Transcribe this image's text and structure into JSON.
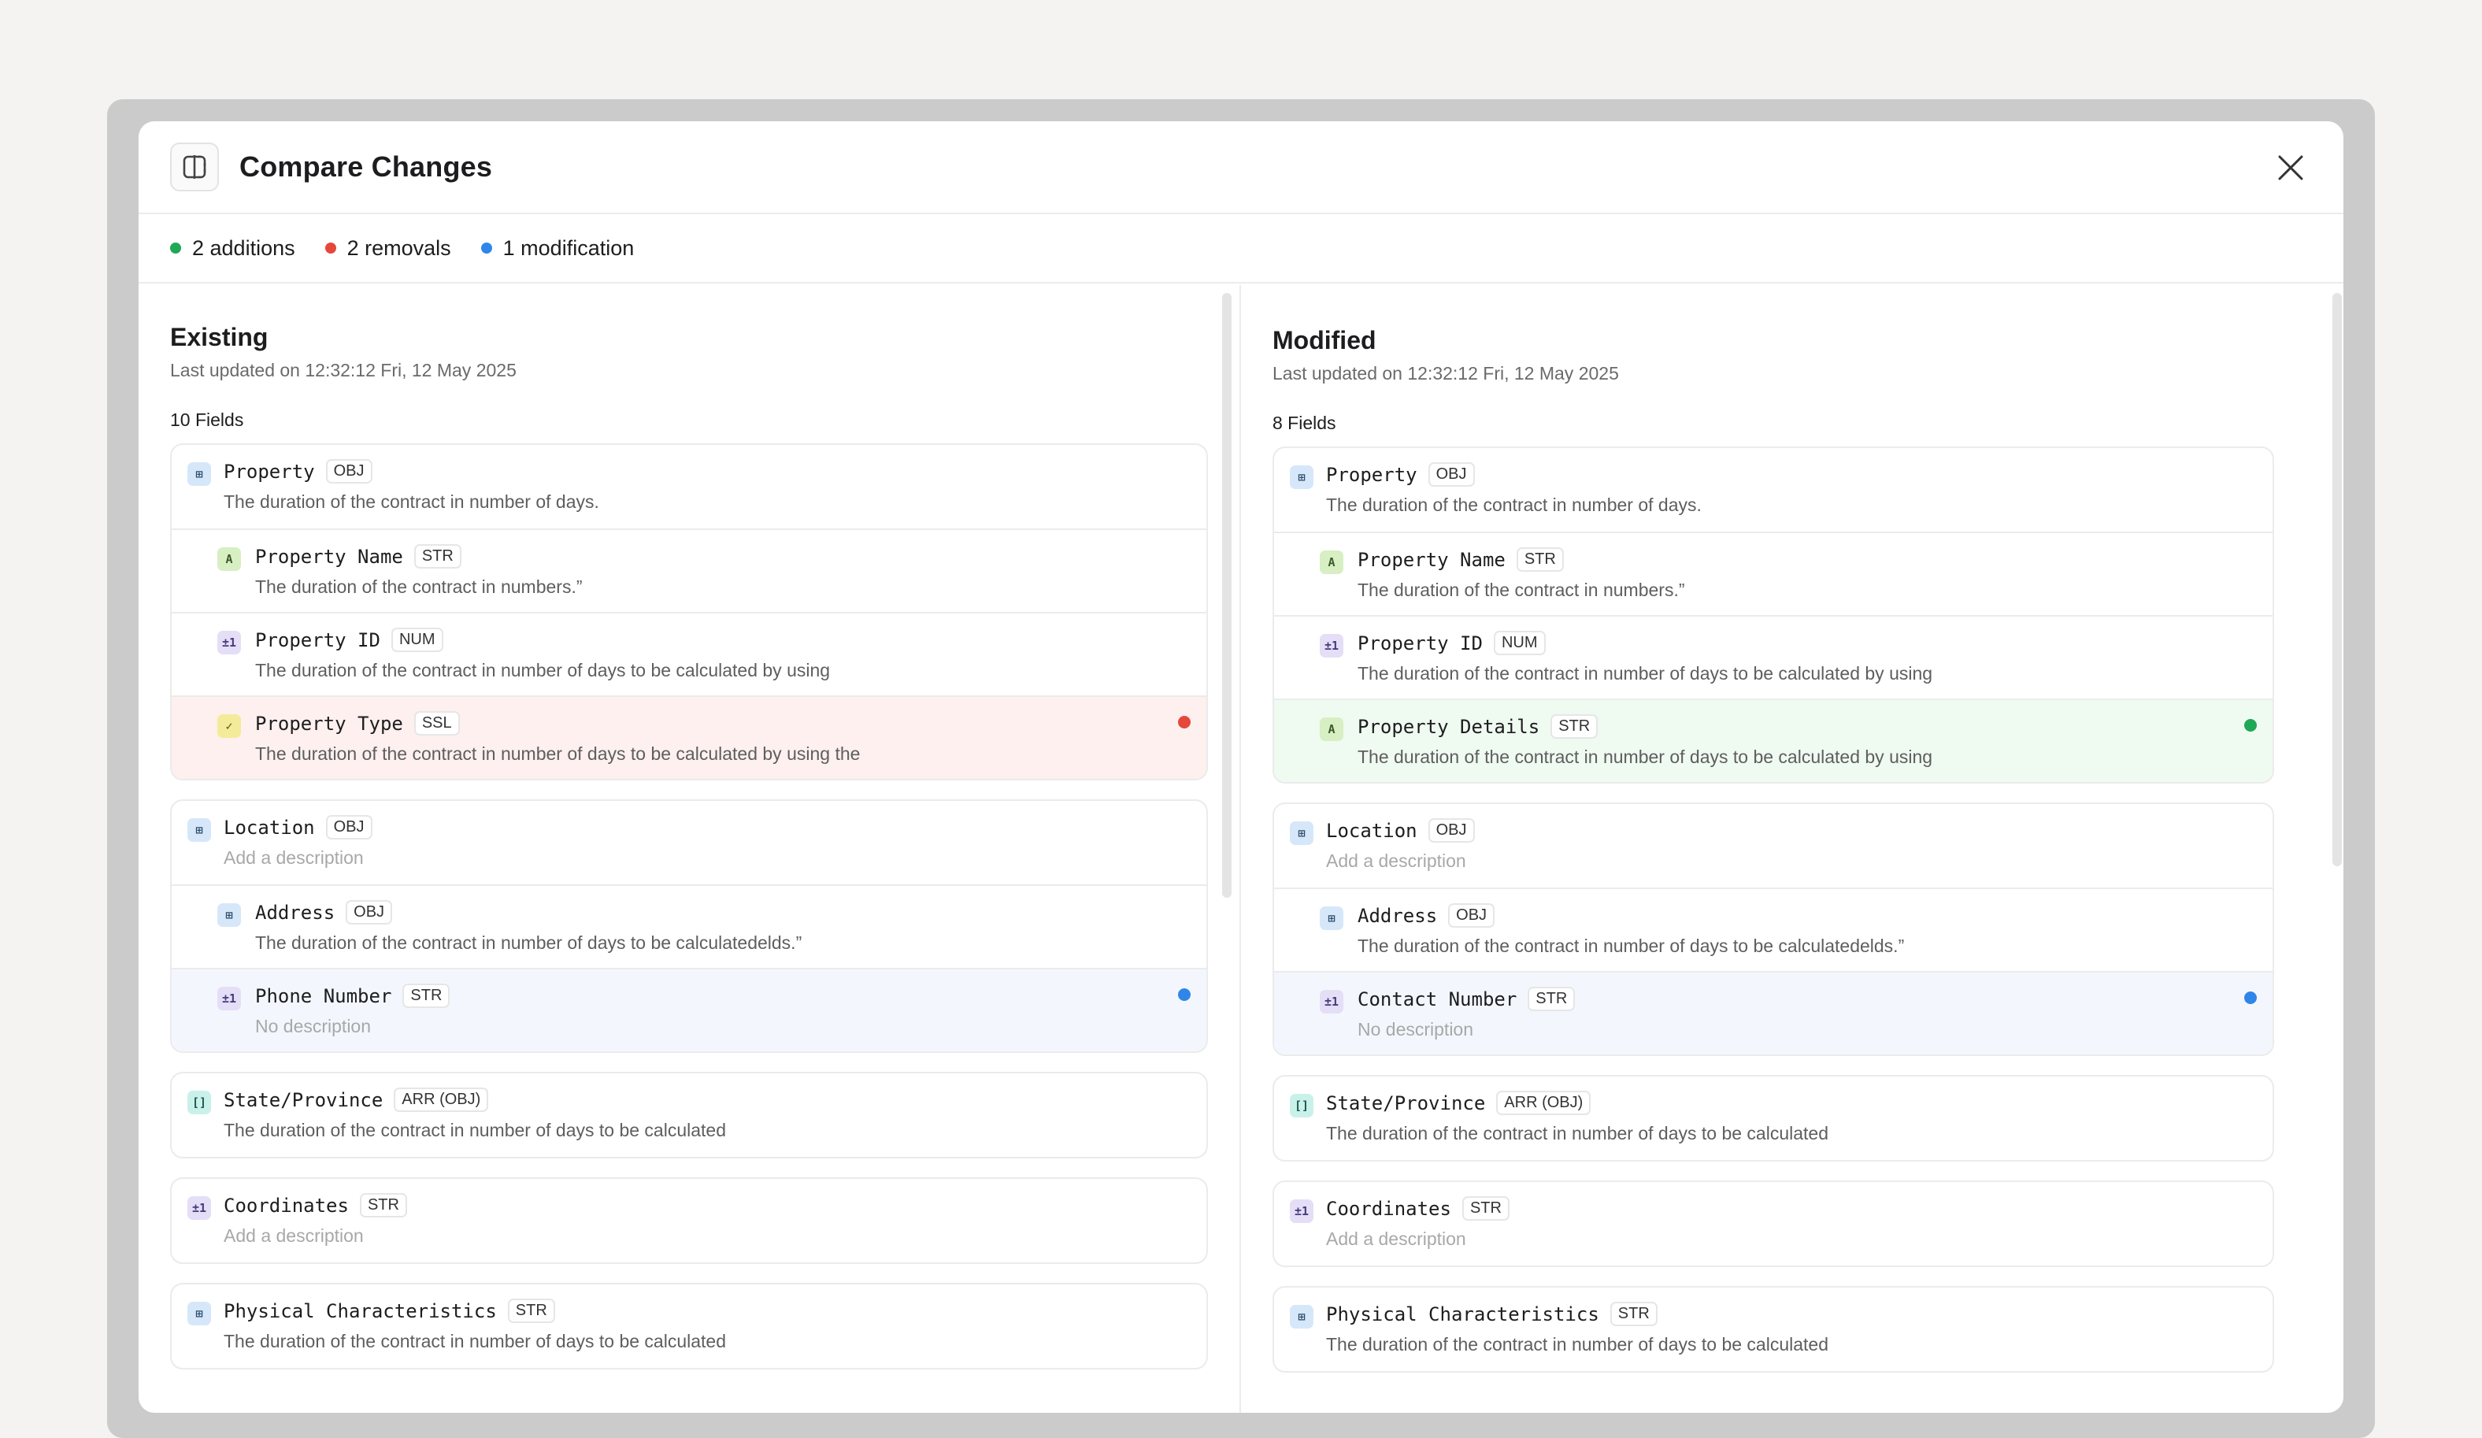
{
  "header": {
    "title": "Compare Changes"
  },
  "summary": [
    {
      "label": "2 additions",
      "color": "#1fa855"
    },
    {
      "label": "2 removals",
      "color": "#e5483b"
    },
    {
      "label": "1 modification",
      "color": "#2f86e8"
    }
  ],
  "existing": {
    "title": "Existing",
    "updated": "Last updated on 12:32:12 Fri, 12 May 2025",
    "field_count": "10 Fields",
    "groups": [
      {
        "rows": [
          {
            "name": "Property",
            "type": "OBJ",
            "icon": "object-icon",
            "desc": "The duration of the contract in number of days.",
            "child": false,
            "state": "",
            "muted": false
          },
          {
            "name": "Property Name",
            "type": "STR",
            "icon": "string-icon",
            "desc": "The duration of the contract in numbers.”",
            "child": true,
            "state": "",
            "muted": false
          },
          {
            "name": "Property ID",
            "type": "NUM",
            "icon": "number-icon",
            "desc": "The duration of the contract in number of days to be calculated by using",
            "child": true,
            "state": "",
            "muted": false
          },
          {
            "name": "Property Type",
            "type": "SSL",
            "icon": "single-select-icon",
            "desc": "The duration of the contract in number of days to be calculated by using the",
            "child": true,
            "state": "removed",
            "muted": false
          }
        ]
      },
      {
        "rows": [
          {
            "name": "Location",
            "type": "OBJ",
            "icon": "object-icon",
            "desc": "Add a description",
            "child": false,
            "state": "",
            "muted": true
          },
          {
            "name": "Address",
            "type": "OBJ",
            "icon": "object-icon",
            "desc": "The duration of the contract in number of days to be calculatedelds.”",
            "child": true,
            "state": "",
            "muted": false
          },
          {
            "name": "Phone Number",
            "type": "STR",
            "icon": "number-icon",
            "desc": "No description",
            "child": true,
            "state": "modified",
            "muted": true
          }
        ]
      },
      {
        "rows": [
          {
            "name": "State/Province",
            "type": "ARR (OBJ)",
            "icon": "array-icon",
            "desc": "The duration of the contract in number of days to be calculated",
            "child": false,
            "state": "",
            "muted": false
          }
        ]
      },
      {
        "rows": [
          {
            "name": "Coordinates",
            "type": "STR",
            "icon": "number-icon",
            "desc": "Add a description",
            "child": false,
            "state": "",
            "muted": true
          }
        ]
      },
      {
        "rows": [
          {
            "name": "Physical Characteristics",
            "type": "STR",
            "icon": "object-icon",
            "desc": "The duration of the contract in number of days to be calculated",
            "child": false,
            "state": "",
            "muted": false
          }
        ]
      }
    ]
  },
  "modified": {
    "title": "Modified",
    "updated": "Last updated on 12:32:12 Fri, 12 May 2025",
    "field_count": "8 Fields",
    "groups": [
      {
        "rows": [
          {
            "name": "Property",
            "type": "OBJ",
            "icon": "object-icon",
            "desc": "The duration of the contract in number of days.",
            "child": false,
            "state": "",
            "muted": false
          },
          {
            "name": "Property Name",
            "type": "STR",
            "icon": "string-icon",
            "desc": "The duration of the contract in numbers.”",
            "child": true,
            "state": "",
            "muted": false
          },
          {
            "name": "Property ID",
            "type": "NUM",
            "icon": "number-icon",
            "desc": "The duration of the contract in number of days to be calculated by using",
            "child": true,
            "state": "",
            "muted": false
          },
          {
            "name": "Property Details",
            "type": "STR",
            "icon": "string-icon",
            "desc": "The duration of the contract in number of days to be calculated by using",
            "child": true,
            "state": "added",
            "muted": false
          }
        ]
      },
      {
        "rows": [
          {
            "name": "Location",
            "type": "OBJ",
            "icon": "object-icon",
            "desc": "Add a description",
            "child": false,
            "state": "",
            "muted": true
          },
          {
            "name": "Address",
            "type": "OBJ",
            "icon": "object-icon",
            "desc": "The duration of the contract in number of days to be calculatedelds.”",
            "child": true,
            "state": "",
            "muted": false
          },
          {
            "name": "Contact Number",
            "type": "STR",
            "icon": "number-icon",
            "desc": "No description",
            "child": true,
            "state": "modified",
            "muted": true
          }
        ]
      },
      {
        "rows": [
          {
            "name": "State/Province",
            "type": "ARR (OBJ)",
            "icon": "array-icon",
            "desc": "The duration of the contract in number of days to be calculated",
            "child": false,
            "state": "",
            "muted": false
          }
        ]
      },
      {
        "rows": [
          {
            "name": "Coordinates",
            "type": "STR",
            "icon": "number-icon",
            "desc": "Add a description",
            "child": false,
            "state": "",
            "muted": true
          }
        ]
      },
      {
        "rows": [
          {
            "name": "Physical Characteristics",
            "type": "STR",
            "icon": "object-icon",
            "desc": "The duration of the contract in number of days to be calculated",
            "child": false,
            "state": "",
            "muted": false
          }
        ]
      }
    ]
  },
  "icon_glyphs": {
    "object-icon": "⊞",
    "string-icon": "A",
    "number-icon": "±1",
    "single-select-icon": "✓",
    "array-icon": "[]"
  },
  "state_colors": {
    "removed": "#e5483b",
    "added": "#1fa855",
    "modified": "#2f86e8"
  }
}
